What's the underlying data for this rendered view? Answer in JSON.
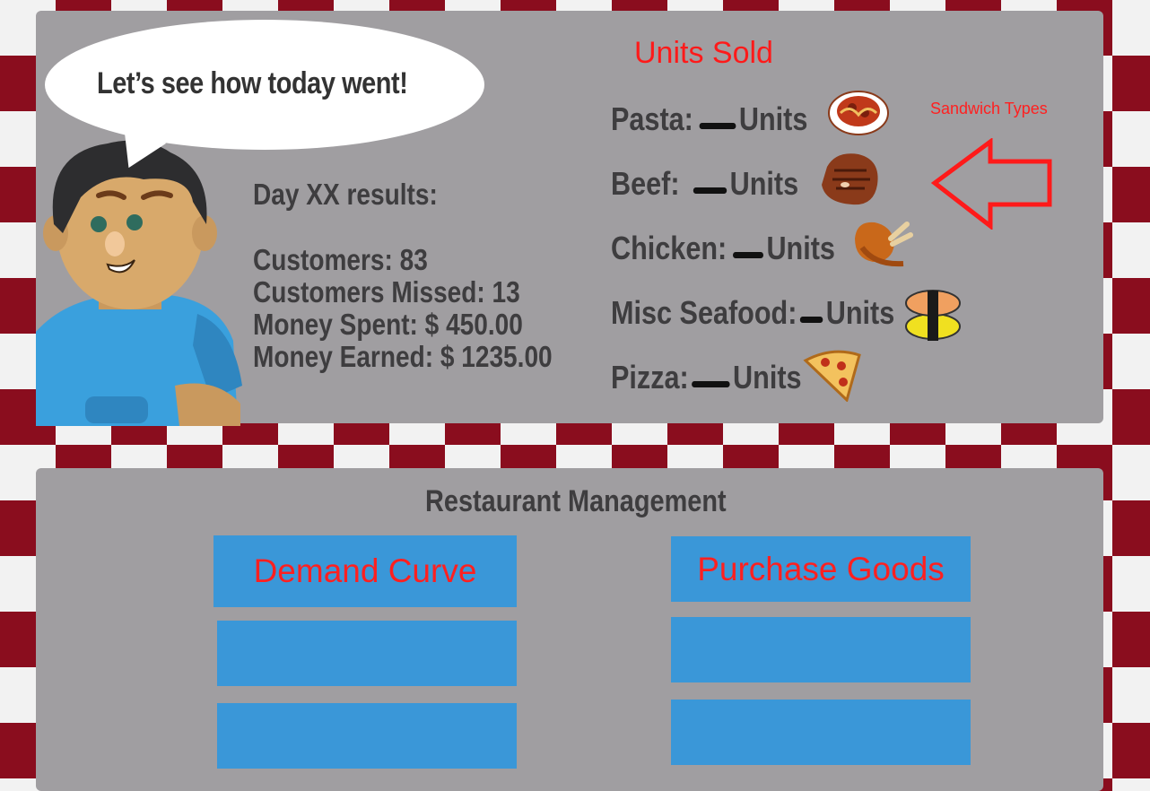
{
  "speech": {
    "text": "Let’s see how today went!"
  },
  "results": {
    "title": "Day XX results:",
    "customers": "Customers: 83",
    "missed": "Customers Missed: 13",
    "spent": "Money Spent: $ 450.00",
    "earned": "Money Earned: $ 1235.00"
  },
  "units": {
    "title": "Units Sold",
    "rows": [
      {
        "label": "Pasta:",
        "suffix": "Units",
        "icon": "pasta-icon"
      },
      {
        "label": "Beef:",
        "suffix": "Units",
        "icon": "steak-icon"
      },
      {
        "label": "Chicken:",
        "suffix": "Units",
        "icon": "chicken-leg-icon"
      },
      {
        "label": "Misc Seafood:",
        "suffix": "Units",
        "icon": "sushi-icon"
      },
      {
        "label": "Pizza:",
        "suffix": "Units",
        "icon": "pizza-slice-icon"
      }
    ]
  },
  "annotation": {
    "text": "Sandwich Types",
    "color": "#ff2020"
  },
  "management": {
    "title": "Restaurant Management",
    "buttons": [
      "Demand Curve",
      "Purchase Goods",
      "",
      "",
      "",
      ""
    ]
  },
  "colors": {
    "checker": "#8a0d1e",
    "panel": "#a09ea1",
    "button": "#3a97d8",
    "accent": "#ff2020"
  }
}
